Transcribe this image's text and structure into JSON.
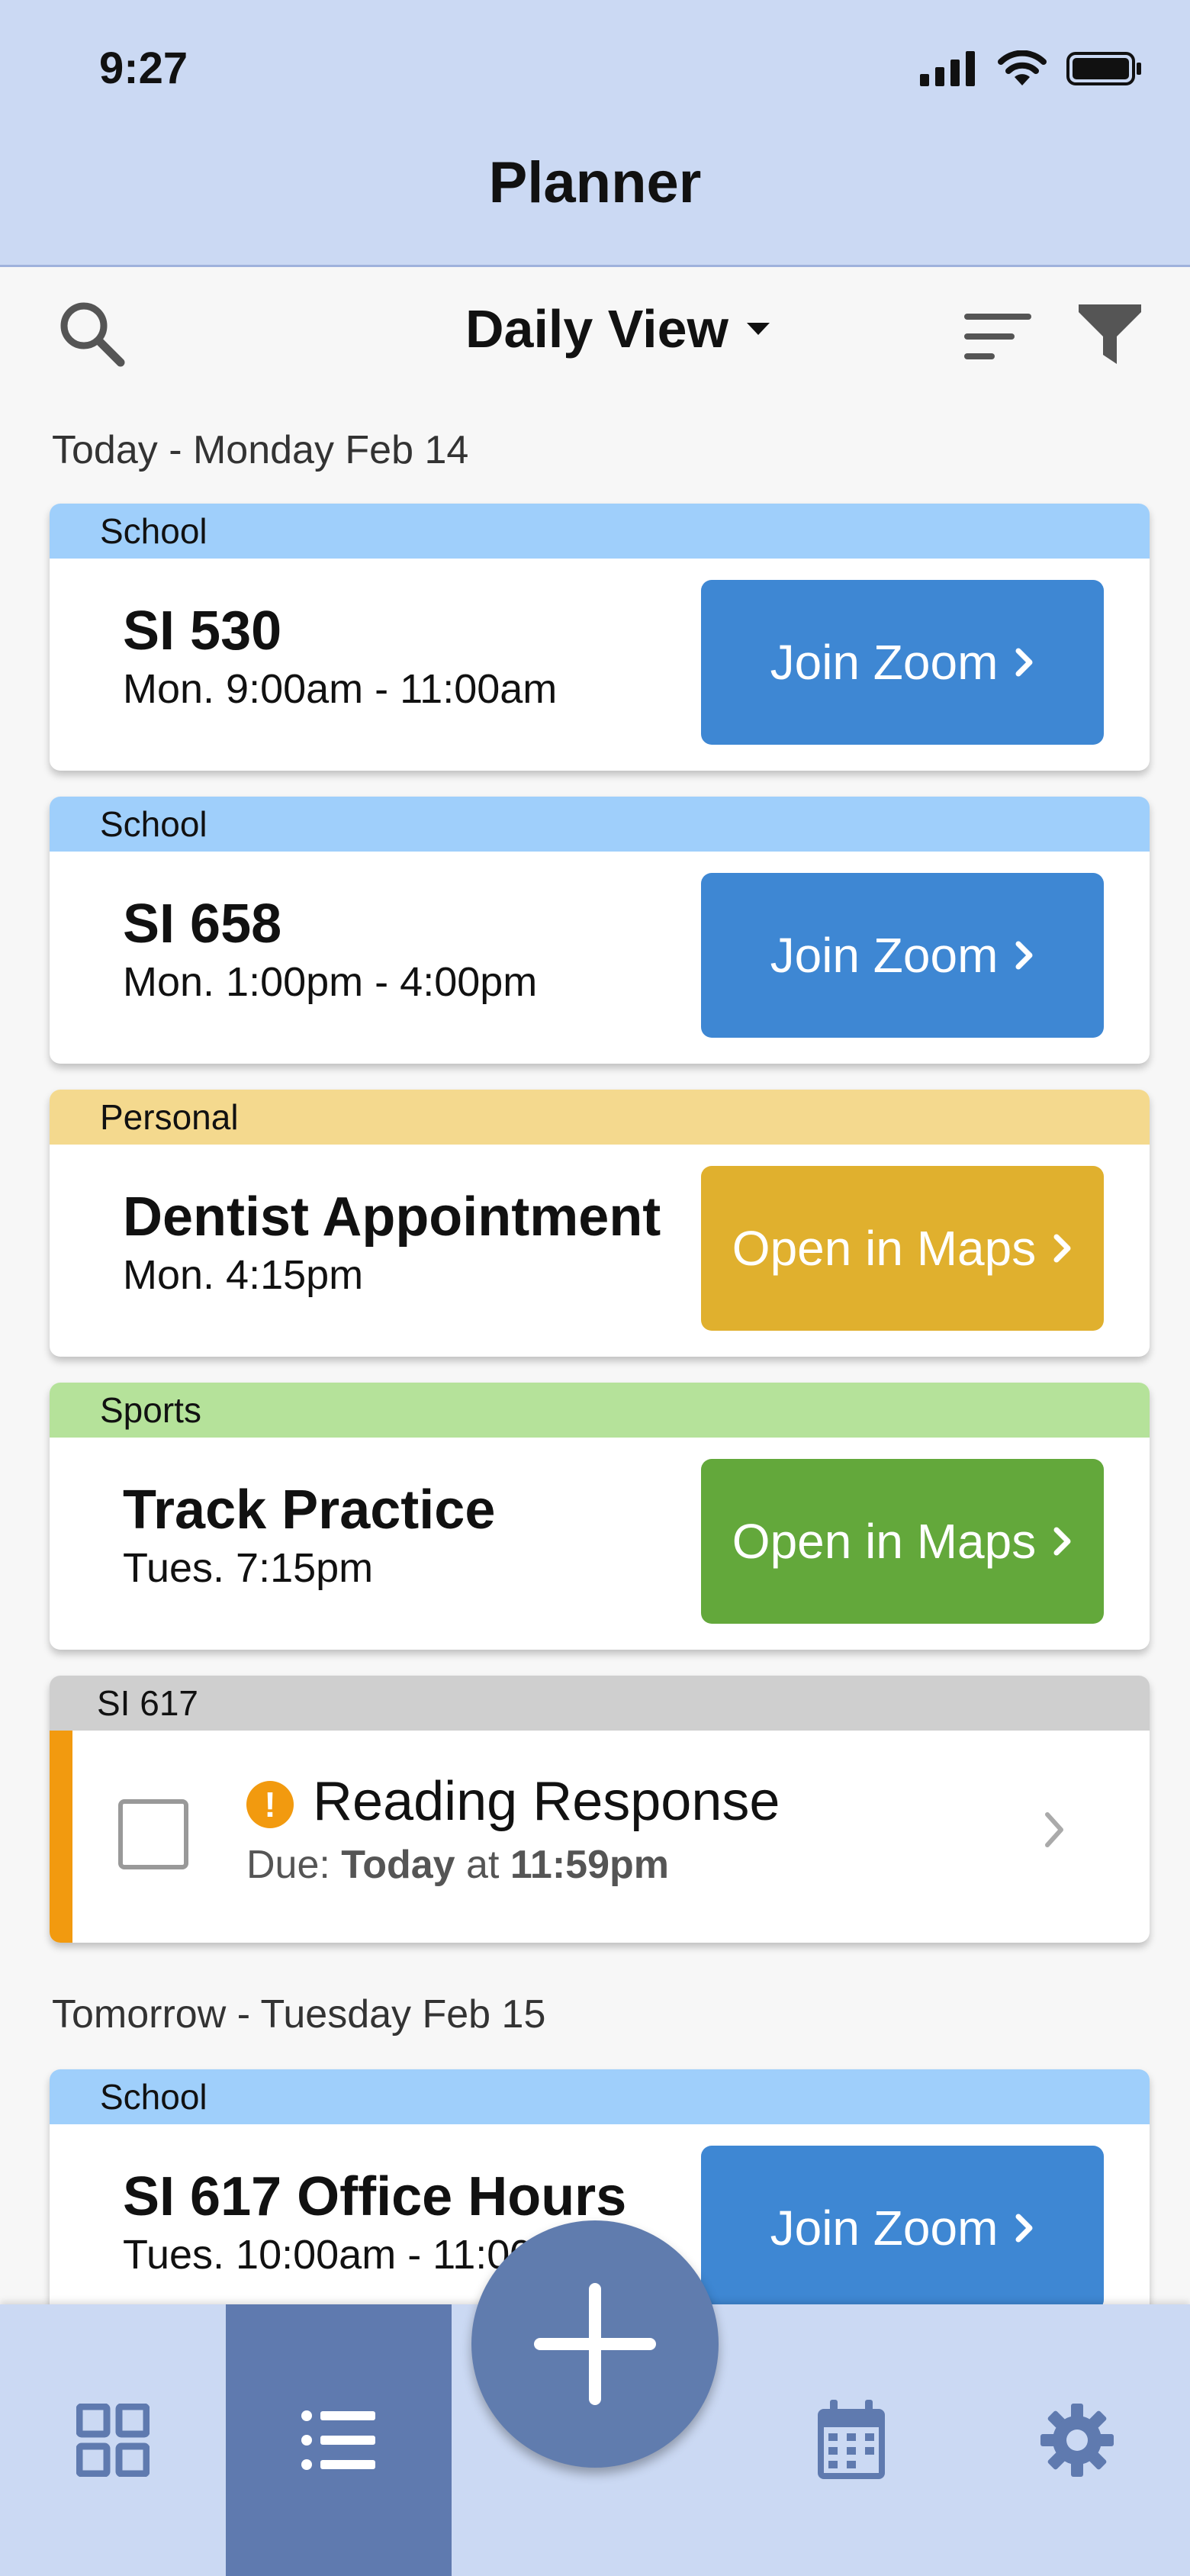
{
  "status_bar": {
    "time": "9:27"
  },
  "header": {
    "title": "Planner"
  },
  "toolbar": {
    "view_label": "Daily View"
  },
  "days": [
    {
      "heading": "Today - Monday Feb 14"
    },
    {
      "heading": "Tomorrow - Tuesday Feb 15"
    }
  ],
  "events": [
    {
      "tag": "School",
      "tag_color": "#9fcffb",
      "name": "SI 530",
      "time": "Mon. 9:00am - 11:00am",
      "button": "Join Zoom",
      "button_color": "#3e87d3"
    },
    {
      "tag": "School",
      "tag_color": "#9fcffb",
      "name": "SI 658",
      "time": "Mon. 1:00pm - 4:00pm",
      "button": "Join Zoom",
      "button_color": "#3e87d3"
    },
    {
      "tag": "Personal",
      "tag_color": "#f4d98e",
      "name": "Dentist Appointment",
      "time": "Mon. 4:15pm",
      "button": "Open in Maps",
      "button_color": "#e0b02e"
    },
    {
      "tag": "Sports",
      "tag_color": "#b5e29a",
      "name": "Track Practice",
      "time": "Tues. 7:15pm",
      "button": "Open in Maps",
      "button_color": "#63a83b"
    },
    {
      "tag": "School",
      "tag_color": "#9fcffb",
      "name": "SI 617 Office Hours",
      "time": "Tues. 10:00am - 11:00am",
      "button": "Join Zoom",
      "button_color": "#3e87d3"
    }
  ],
  "task": {
    "tag": "SI 617",
    "tag_color": "#cfcfcf",
    "accent_color": "#f29a0f",
    "name": "Reading Response",
    "due_prefix": "Due:",
    "due_day": "Today",
    "due_mid": "at",
    "due_time": "11:59pm",
    "checked": false
  },
  "tabbar": {
    "tabs": [
      {
        "icon": "grid-icon",
        "active": false
      },
      {
        "icon": "list-icon",
        "active": true
      },
      {
        "icon": "plus-icon",
        "active": false
      },
      {
        "icon": "calendar-icon",
        "active": false
      },
      {
        "icon": "gear-icon",
        "active": false
      }
    ]
  }
}
